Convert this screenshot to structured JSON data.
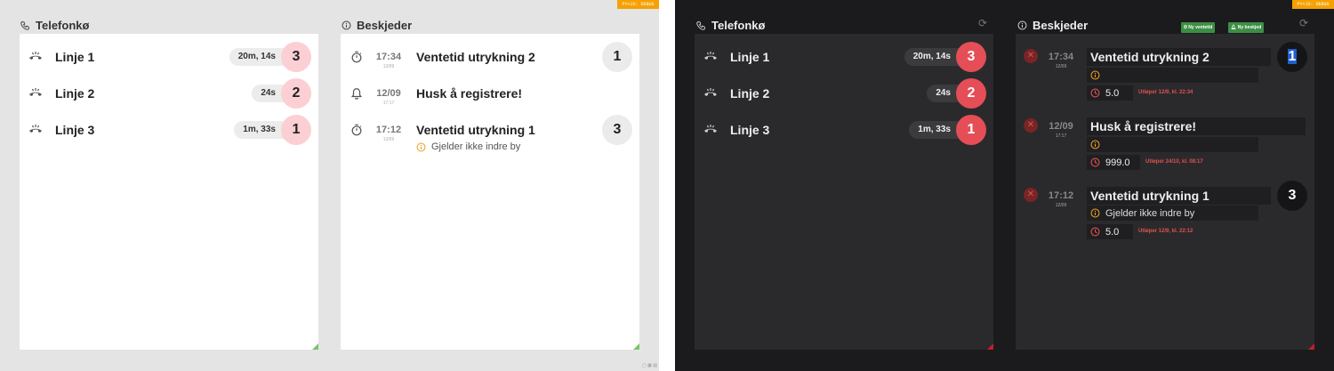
{
  "debug_label": "PY+JS: DEBUG",
  "phone_queue": {
    "title": "Telefonkø",
    "lines": [
      {
        "label": "Linje 1",
        "wait": "20m, 14s",
        "count": "3"
      },
      {
        "label": "Linje 2",
        "wait": "24s",
        "count": "2"
      },
      {
        "label": "Linje 3",
        "wait": "1m, 33s",
        "count": "1"
      }
    ]
  },
  "messages": {
    "title": "Beskjeder",
    "new_wait_label": "Ny ventetid",
    "new_message_label": "Ny beskjed",
    "items": [
      {
        "icon": "timer-icon",
        "time": "17:34",
        "date": "12/09",
        "title": "Ventetid utrykning 2",
        "note": "",
        "value": "5.0",
        "expires": "Utløper 12/9, kl. 22:34",
        "count": "1"
      },
      {
        "icon": "bell-icon",
        "time": "12/09",
        "date": "17:17",
        "title": "Husk å registrere!",
        "note": "",
        "value": "999.0",
        "expires": "Utløper 24/10, kl. 08:17",
        "count": ""
      },
      {
        "icon": "timer-icon",
        "time": "17:12",
        "date": "12/09",
        "title": "Ventetid utrykning 1",
        "note": "Gjelder ikke indre by",
        "value": "5.0",
        "expires": "Utløper 12/9, kl. 22:12",
        "count": "3"
      }
    ]
  },
  "colors": {
    "accent_debug": "#f5a100",
    "badge_red_dark": "#e54e56",
    "badge_red_light": "#fbcfd3",
    "info_orange": "#f0a020",
    "green_button": "#3d8e45"
  }
}
